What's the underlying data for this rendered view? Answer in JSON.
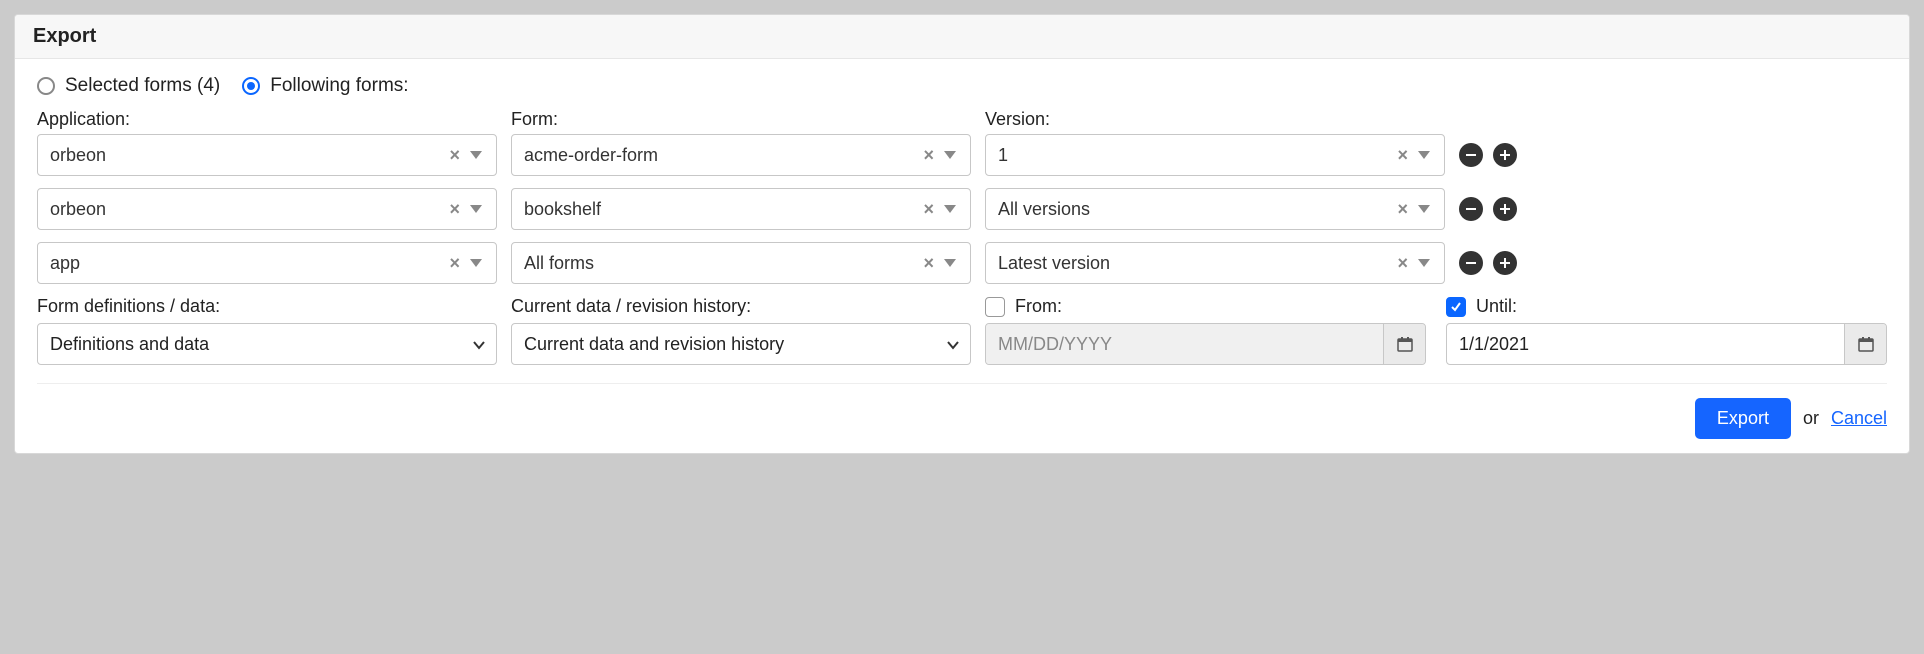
{
  "header": {
    "title": "Export"
  },
  "scope": {
    "options": [
      {
        "label": "Selected forms (4)",
        "checked": false
      },
      {
        "label": "Following forms:",
        "checked": true
      }
    ]
  },
  "columns": {
    "application_label": "Application:",
    "form_label": "Form:",
    "version_label": "Version:"
  },
  "rows": [
    {
      "application": "orbeon",
      "form": "acme-order-form",
      "version": "1"
    },
    {
      "application": "orbeon",
      "form": "bookshelf",
      "version": "All versions"
    },
    {
      "application": "app",
      "form": "All forms",
      "version": "Latest version"
    }
  ],
  "defs": {
    "label": "Form definitions / data:",
    "value": "Definitions and data"
  },
  "history": {
    "label": "Current data / revision history:",
    "value": "Current data and revision history"
  },
  "from": {
    "label": "From:",
    "checked": false,
    "placeholder": "MM/DD/YYYY",
    "value": ""
  },
  "until": {
    "label": "Until:",
    "checked": true,
    "value": "1/1/2021"
  },
  "footer": {
    "export_label": "Export",
    "or_label": "or",
    "cancel_label": "Cancel"
  }
}
